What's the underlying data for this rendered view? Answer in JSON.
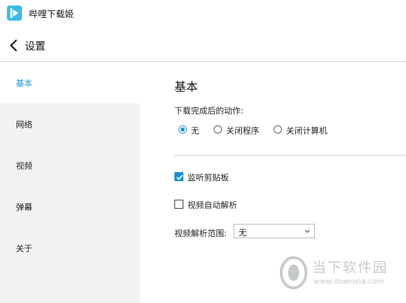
{
  "app": {
    "title": "哔哩下载姬",
    "icon": "play-logo-icon",
    "accent": "#3dbbe7"
  },
  "header": {
    "back_icon": "chevron-left-icon",
    "title": "设置"
  },
  "sidebar": {
    "items": [
      {
        "label": "基本",
        "active": true
      },
      {
        "label": "网络",
        "active": false
      },
      {
        "label": "视频",
        "active": false
      },
      {
        "label": "弹幕",
        "active": false
      },
      {
        "label": "关于",
        "active": false
      }
    ]
  },
  "content": {
    "section_title": "基本",
    "after_download": {
      "label": "下载完成后的动作:",
      "options": [
        {
          "label": "无",
          "selected": true
        },
        {
          "label": "关闭程序",
          "selected": false
        },
        {
          "label": "关闭计算机",
          "selected": false
        }
      ]
    },
    "checkboxes": [
      {
        "label": "监听剪贴板",
        "checked": true
      },
      {
        "label": "视频自动解析",
        "checked": false
      }
    ],
    "parse_range": {
      "label": "视频解析范围:",
      "value": "无"
    }
  },
  "watermark": {
    "name": "当下软件园",
    "url": "www.downxia.com"
  },
  "colors": {
    "accent_blue": "#1a8fd1",
    "sidebar_bg": "#f2f2f2",
    "divider": "#cfcfcf"
  }
}
